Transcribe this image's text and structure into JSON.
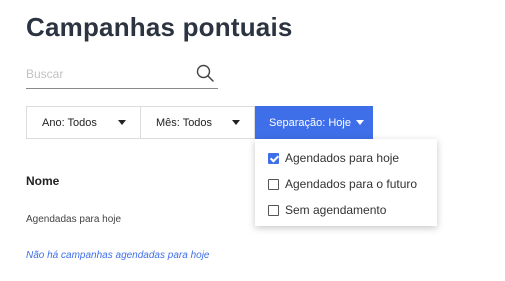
{
  "page": {
    "title": "Campanhas pontuais"
  },
  "search": {
    "placeholder": "Buscar",
    "value": "",
    "icon": "search-icon"
  },
  "filters": {
    "year_label": "Ano: Todos",
    "month_label": "Mês: Todos",
    "separation_label": "Separação: Hoje",
    "active_color": "#3f6fe8"
  },
  "separation_menu": {
    "options": [
      {
        "label": "Agendados para hoje",
        "checked": true
      },
      {
        "label": "Agendados para o futuro",
        "checked": false
      },
      {
        "label": "Sem agendamento",
        "checked": false
      }
    ]
  },
  "table": {
    "column_name": "Nome",
    "section_label": "Agendadas para hoje",
    "empty_message": "Não há campanhas agendadas para hoje"
  }
}
